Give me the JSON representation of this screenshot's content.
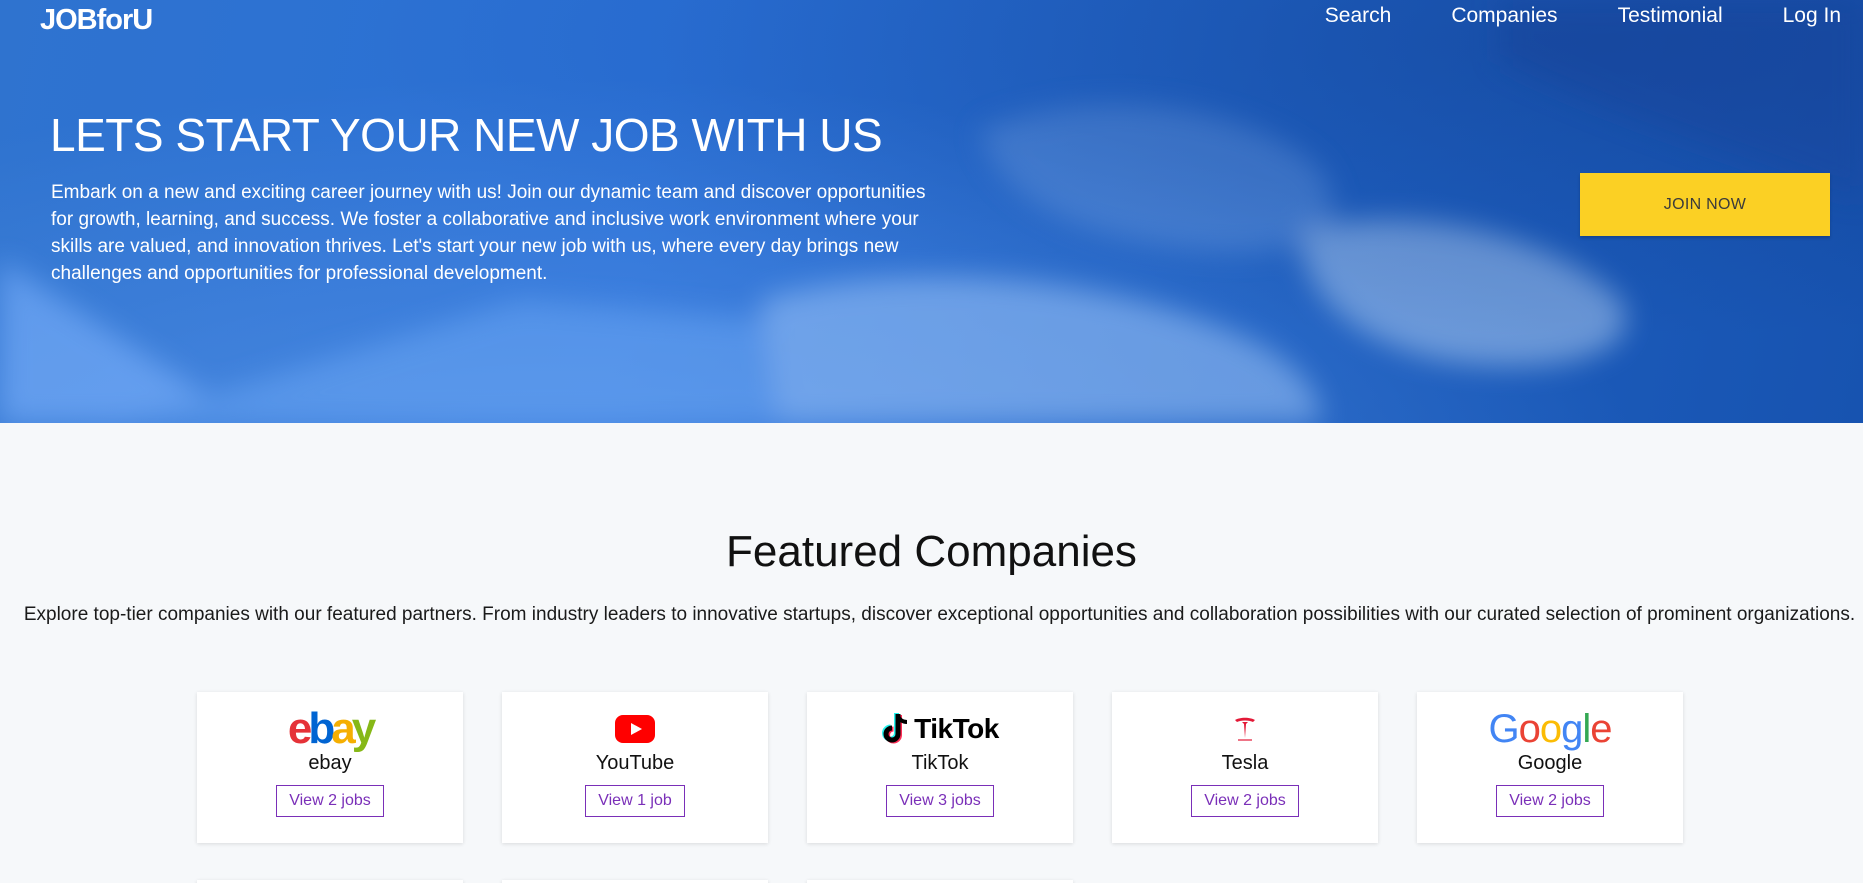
{
  "header": {
    "logo": "JOBforU",
    "nav": [
      "Search",
      "Companies",
      "Testimonial",
      "Log In"
    ]
  },
  "hero": {
    "title": "LETS START YOUR NEW JOB WITH US",
    "text": "Embark on a new and exciting career journey with us! Join our dynamic team and discover opportunities for growth, learning, and success. We foster a collaborative and inclusive work environment where your skills are valued, and innovation thrives. Let's start your new job with us, where every day brings new challenges and opportunities for professional development.",
    "cta": "JOIN NOW",
    "cta_color": "#fbd024",
    "bg_color": "#2a70d6"
  },
  "featured": {
    "title": "Featured Companies",
    "description": "Explore top-tier companies with our featured partners. From industry leaders to innovative startups, discover exceptional opportunities and collaboration possibilities with our curated selection of prominent organizations.",
    "companies": [
      {
        "name": "ebay",
        "logo": "ebay-logo",
        "button": "View 2 jobs"
      },
      {
        "name": "YouTube",
        "logo": "youtube-logo",
        "button": "View 1 job"
      },
      {
        "name": "TikTok",
        "logo": "tiktok-logo",
        "logo_text": "TikTok",
        "button": "View 3 jobs"
      },
      {
        "name": "Tesla",
        "logo": "tesla-logo",
        "button": "View 2 jobs"
      },
      {
        "name": "Google",
        "logo": "google-logo",
        "button": "View 2 jobs"
      }
    ],
    "accent_color": "#7a2fb8"
  }
}
